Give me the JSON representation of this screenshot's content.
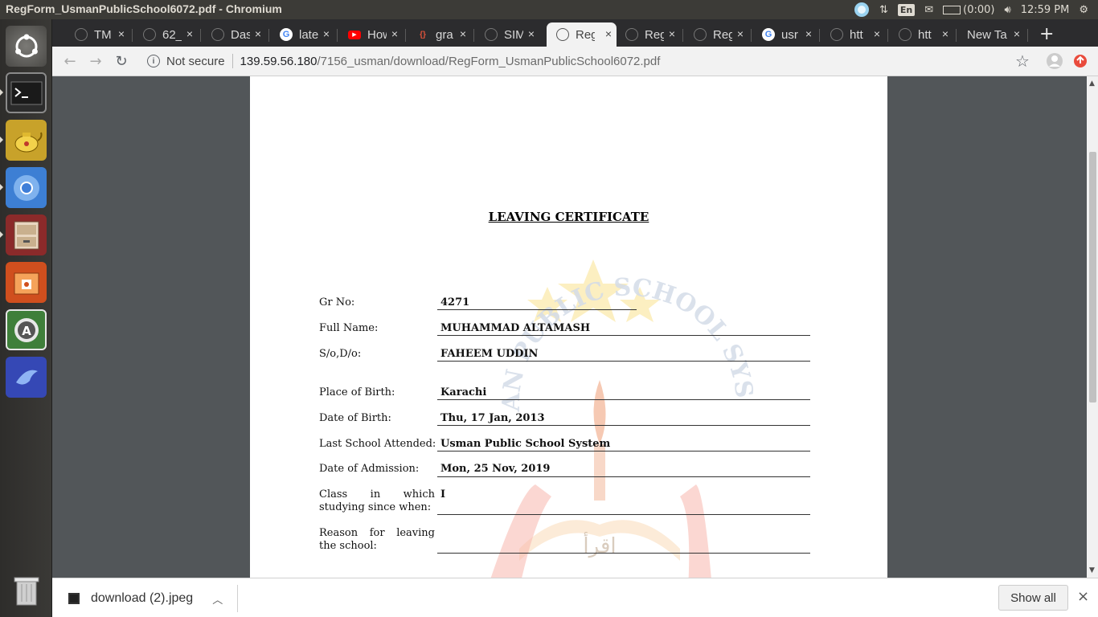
{
  "system": {
    "window_title": "RegForm_UsmanPublicSchool6072.pdf - Chromium",
    "lang": "En",
    "battery": "(0:00)",
    "clock": "12:59 PM"
  },
  "tabs": [
    {
      "label": "TM",
      "active": false
    },
    {
      "label": "62_",
      "active": false
    },
    {
      "label": "Das",
      "active": false
    },
    {
      "label": "late",
      "active": false
    },
    {
      "label": "How",
      "active": false
    },
    {
      "label": "gra",
      "active": false
    },
    {
      "label": "SIM",
      "active": false
    },
    {
      "label": "Reg",
      "active": true
    },
    {
      "label": "Reg",
      "active": false
    },
    {
      "label": "Reg",
      "active": false
    },
    {
      "label": "usr",
      "active": false
    },
    {
      "label": "htt",
      "active": false
    },
    {
      "label": "htt",
      "active": false
    },
    {
      "label": "New Ta",
      "active": false
    }
  ],
  "address": {
    "security": "Not secure",
    "host": "139.59.56.180",
    "path": "/7156_usman/download/RegForm_UsmanPublicSchool6072.pdf"
  },
  "document": {
    "title": "LEAVING CERTIFICATE",
    "watermark_text": "USMAN PUBLIC SCHOOL SYSTEM",
    "watermark_script": "اقرأ",
    "fields": [
      {
        "label": "Gr No:",
        "value": "4271"
      },
      {
        "label": "Full Name:",
        "value": "MUHAMMAD ALTAMASH"
      },
      {
        "label": "S/o,D/o:",
        "value": "FAHEEM UDDIN"
      },
      {
        "label": "Place of Birth:",
        "value": "Karachi"
      },
      {
        "label": "Date of Birth:",
        "value": "Thu, 17 Jan, 2013"
      },
      {
        "label": "Last School Attended:",
        "value": "Usman Public School System"
      },
      {
        "label": "Date of Admission:",
        "value": "Mon, 25 Nov, 2019"
      },
      {
        "label": "Class in which studying since when:",
        "value": "I"
      },
      {
        "label": "Reason for leaving the school:",
        "value": ""
      }
    ]
  },
  "downloads": {
    "file_name": "download (2).jpeg",
    "show_all_label": "Show all"
  },
  "icons": {
    "close": "×",
    "new_tab": "+",
    "back": "←",
    "forward": "→",
    "reload": "↻",
    "star": "☆",
    "chevron_up": "︿"
  }
}
